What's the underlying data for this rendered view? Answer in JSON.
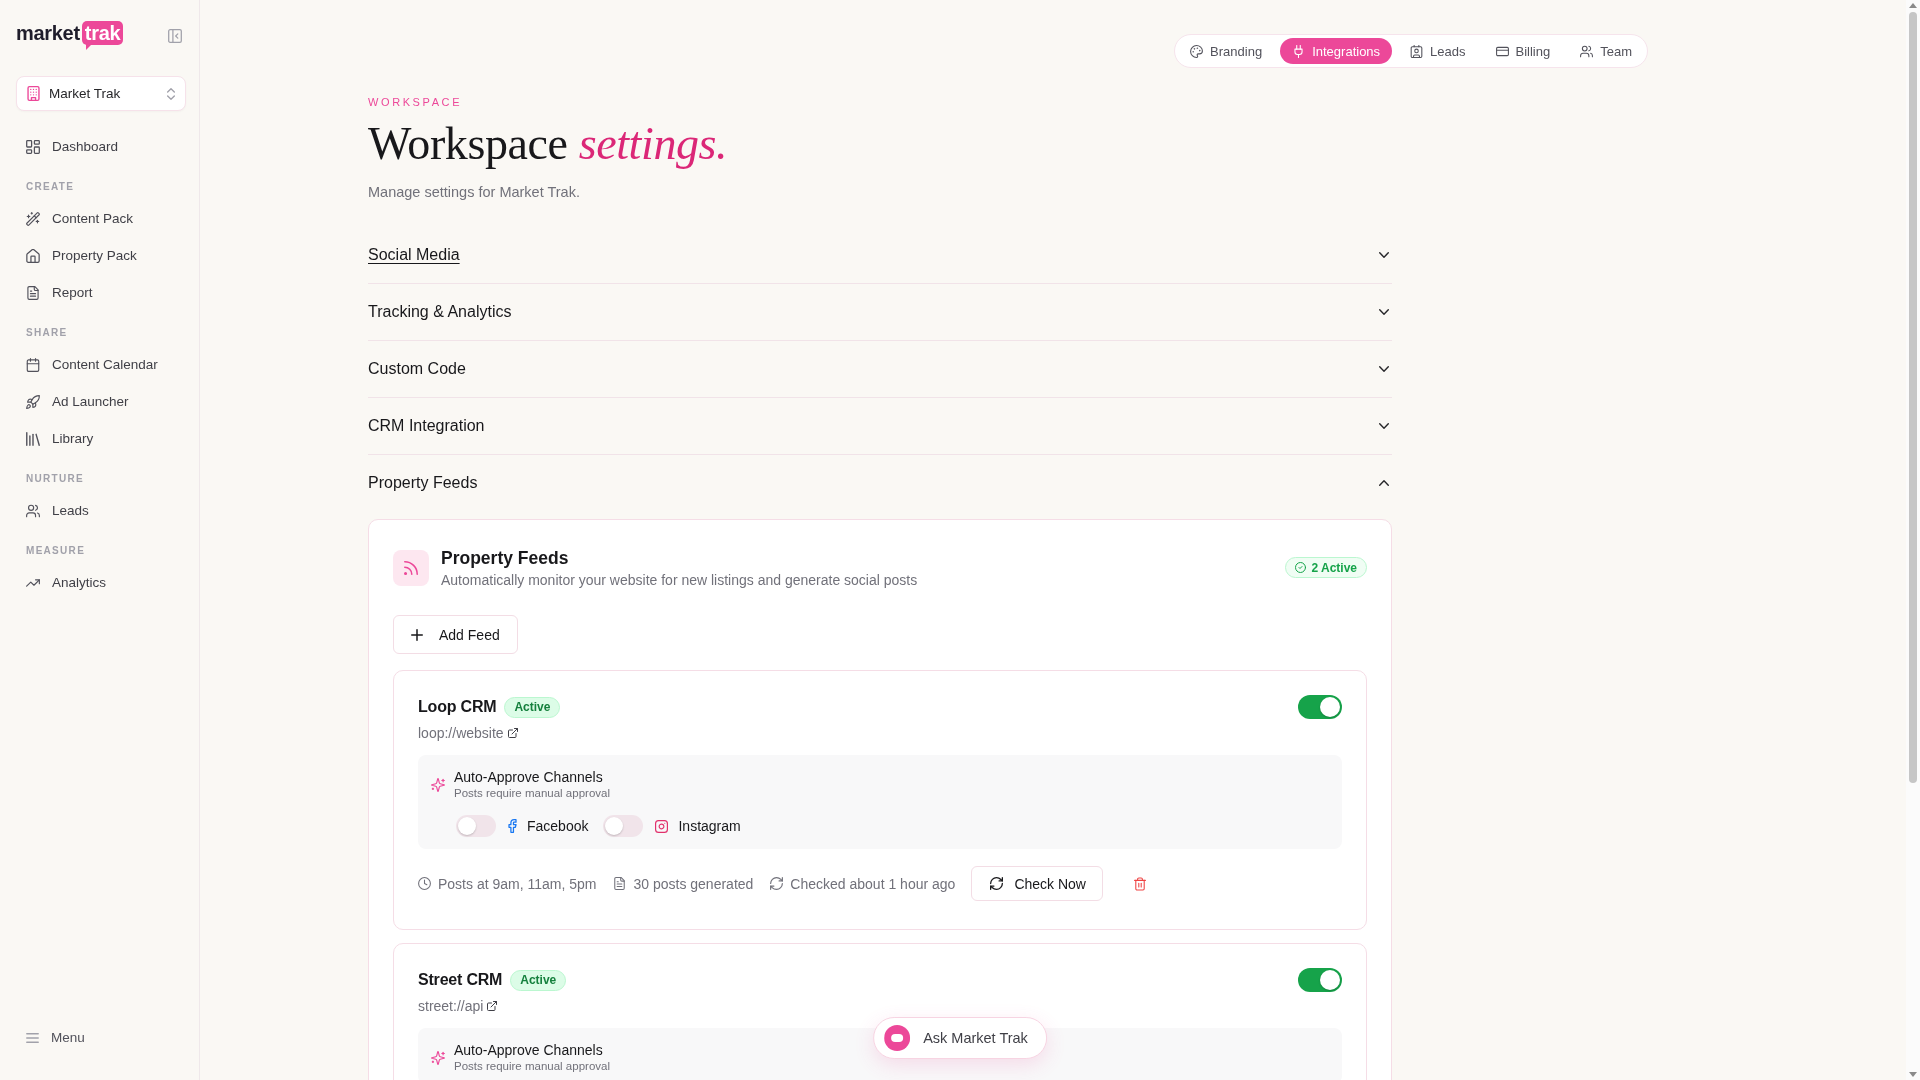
{
  "sidebar": {
    "logo": {
      "text": "market",
      "highlight": "trak"
    },
    "workspace_selector": {
      "value": "Market Trak"
    },
    "items": [
      {
        "label": "Dashboard",
        "selected": false
      }
    ],
    "groups": [
      {
        "label": "CREATE",
        "items": [
          {
            "label": "Content Pack",
            "selected": false
          },
          {
            "label": "Property Pack",
            "selected": false
          },
          {
            "label": "Report",
            "selected": false
          }
        ]
      },
      {
        "label": "SHARE",
        "items": [
          {
            "label": "Content Calendar",
            "selected": false
          },
          {
            "label": "Ad Launcher",
            "selected": false
          },
          {
            "label": "Library",
            "selected": false
          }
        ]
      },
      {
        "label": "NURTURE",
        "items": [
          {
            "label": "Leads",
            "selected": false
          }
        ]
      },
      {
        "label": "MEASURE",
        "items": [
          {
            "label": "Analytics",
            "selected": false
          }
        ]
      }
    ],
    "menu": {
      "label": "Menu"
    }
  },
  "top_tabs": [
    {
      "label": "Branding",
      "selected": false
    },
    {
      "label": "Integrations",
      "selected": true
    },
    {
      "label": "Leads",
      "selected": false
    },
    {
      "label": "Billing",
      "selected": false
    },
    {
      "label": "Team",
      "selected": false
    }
  ],
  "header": {
    "eyebrow": "WORKSPACE",
    "title": "Workspace *settings.*",
    "subtitle": "Manage settings for Market Trak."
  },
  "sections": [
    {
      "title": "Social Media",
      "expanded": false,
      "hovered": true
    },
    {
      "title": "Tracking & Analytics",
      "expanded": false,
      "hovered": false
    },
    {
      "title": "Custom Code",
      "expanded": false,
      "hovered": false
    },
    {
      "title": "CRM Integration",
      "expanded": false,
      "hovered": false
    },
    {
      "title": "Property Feeds",
      "expanded": true,
      "hovered": false
    }
  ],
  "property_feeds": {
    "title": "Property Feeds",
    "description": "Automatically monitor your website for new listings and generate social posts",
    "badge": "2 Active",
    "add_button": "Add Feed",
    "feeds": [
      {
        "name": "Loop CRM",
        "status": "Active",
        "enabled": true,
        "url": "loop://website",
        "auto_approve": {
          "title": "Auto-Approve Channels",
          "subtitle": "Posts require manual approval",
          "channels": [
            {
              "kind": "facebook",
              "label": "Facebook",
              "on": false
            },
            {
              "kind": "instagram",
              "label": "Instagram",
              "on": false
            }
          ]
        },
        "schedule": "Posts at 9am, 11am, 5pm",
        "generated": "30 posts generated",
        "checked": "Checked about 1 hour ago",
        "check_button": "Check Now"
      },
      {
        "name": "Street CRM",
        "status": "Active",
        "enabled": true,
        "url": "street://api",
        "auto_approve": {
          "title": "Auto-Approve Channels",
          "subtitle": "Posts require manual approval"
        }
      }
    ]
  },
  "assistant_button": {
    "label": "Ask Market Trak"
  }
}
